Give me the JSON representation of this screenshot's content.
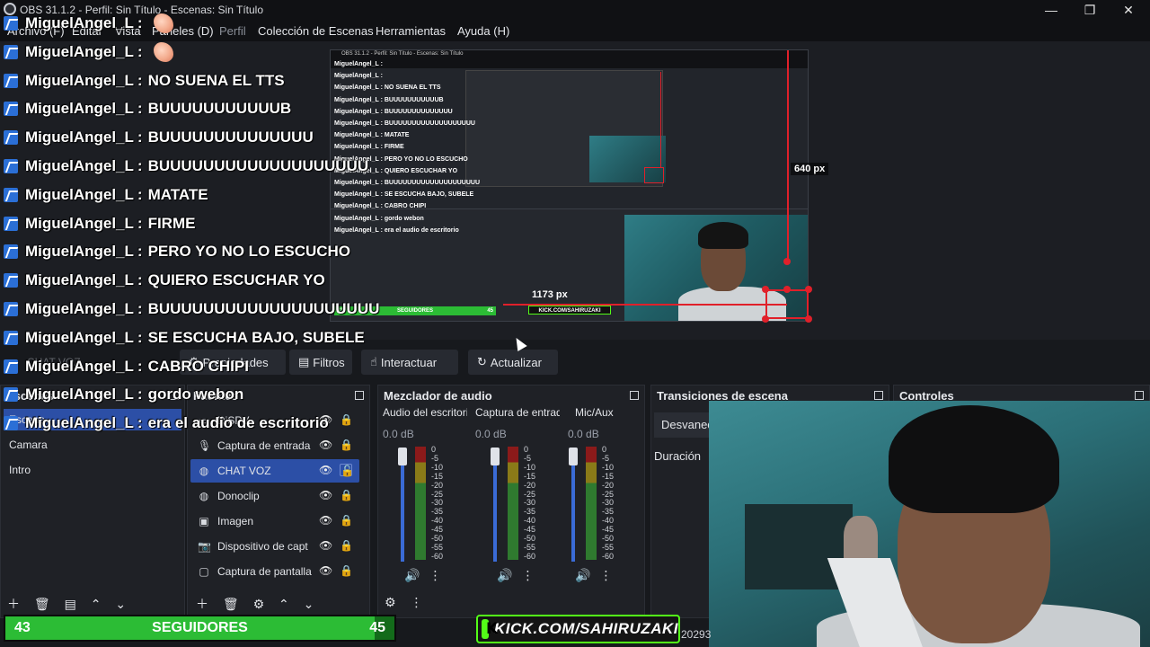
{
  "window": {
    "title": "OBS 31.1.2 - Perfil: Sin Título - Escenas: Sin Título",
    "minimize": "—",
    "maximize": "❐",
    "close": "✕"
  },
  "menu": [
    "Archivo (F)",
    "Editar",
    "Vista",
    "Paneles (D)",
    "Perfil",
    "Colección de Escenas",
    "Herramientas",
    "Ayuda (H)"
  ],
  "chat": [
    {
      "user": "MiguelAngel_L",
      "msg": "",
      "emoji": "👌"
    },
    {
      "user": "MiguelAngel_L",
      "msg": "",
      "emoji": "👌"
    },
    {
      "user": "MiguelAngel_L",
      "msg": "NO SUENA EL TTS"
    },
    {
      "user": "MiguelAngel_L",
      "msg": "BUUUUUUUUUUUB"
    },
    {
      "user": "MiguelAngel_L",
      "msg": "BUUUUUUUUUUUUUU"
    },
    {
      "user": "MiguelAngel_L",
      "msg": "BUUUUUUUUUUUUUUUUUUU"
    },
    {
      "user": "MiguelAngel_L",
      "msg": "MATATE"
    },
    {
      "user": "MiguelAngel_L",
      "msg": "FIRME"
    },
    {
      "user": "MiguelAngel_L",
      "msg": "PERO YO NO LO ESCUCHO"
    },
    {
      "user": "MiguelAngel_L",
      "msg": "QUIERO ESCUCHAR YO"
    },
    {
      "user": "MiguelAngel_L",
      "msg": "BUUUUUUUUUUUUUUUUUUUU"
    },
    {
      "user": "MiguelAngel_L",
      "msg": "SE ESCUCHA BAJO, SUBELE"
    },
    {
      "user": "MiguelAngel_L",
      "msg": "CABRO CHIPI"
    },
    {
      "user": "MiguelAngel_L",
      "msg": "gordo webon"
    },
    {
      "user": "MiguelAngel_L",
      "msg": "era el audio de escritorio"
    }
  ],
  "preview": {
    "width_label": "640 px",
    "height_label": "1173 px",
    "mini_title": "OBS 31.1.2 - Perfil: Sin Título - Escenas: Sin Título",
    "mini_followers_left": "43",
    "mini_followers_label": "SEGUIDORES",
    "mini_followers_right": "45",
    "mini_kick": "KICK.COM/SAHIRUZAKI"
  },
  "source_toolbar": {
    "properties": "Propiedades",
    "filters": "Filtros",
    "interact": "Interactuar",
    "refresh": "Actualizar",
    "selected_source": "CHAT VOZ"
  },
  "scenes": {
    "header": "Escenas",
    "items": [
      "Escena",
      "Camara",
      "Intro"
    ]
  },
  "sources": {
    "header": "Fuentes",
    "items": [
      {
        "name": "DiSPV",
        "icon": "window-icon"
      },
      {
        "name": "Captura de entrada",
        "icon": "microphone-icon"
      },
      {
        "name": "CHAT VOZ",
        "icon": "globe-icon",
        "selected": true
      },
      {
        "name": "Donoclip",
        "icon": "globe-icon"
      },
      {
        "name": "Imagen",
        "icon": "image-icon"
      },
      {
        "name": "Dispositivo de capt",
        "icon": "camera-icon"
      },
      {
        "name": "Captura de pantalla",
        "icon": "monitor-icon"
      }
    ]
  },
  "mixer": {
    "header": "Mezclador de audio",
    "channels": [
      {
        "name": "Audio del escritorio",
        "db": "0.0 dB"
      },
      {
        "name": "Captura de entrada",
        "db": "0.0 dB"
      },
      {
        "name": "Mic/Aux",
        "db": "0.0 dB"
      }
    ],
    "scale": [
      "0",
      "-5",
      "-10",
      "-15",
      "-20",
      "-25",
      "-30",
      "-35",
      "-40",
      "-45",
      "-50",
      "-55",
      "-60"
    ]
  },
  "transitions": {
    "header": "Transiciones de escena",
    "selected": "Desvanecer",
    "duration_label": "Duración"
  },
  "controls": {
    "header": "Controles"
  },
  "overlay": {
    "followers_current": "43",
    "followers_label": "SEGUIDORES",
    "followers_goal": "45",
    "kick_text": "KICK.COM/SAHIRUZAKI",
    "status_number": "20293"
  },
  "colors": {
    "accent": "#2c4fa6",
    "kick_green": "#53fc18",
    "follower_green": "#2cbc35",
    "guide_red": "#e0202a"
  }
}
